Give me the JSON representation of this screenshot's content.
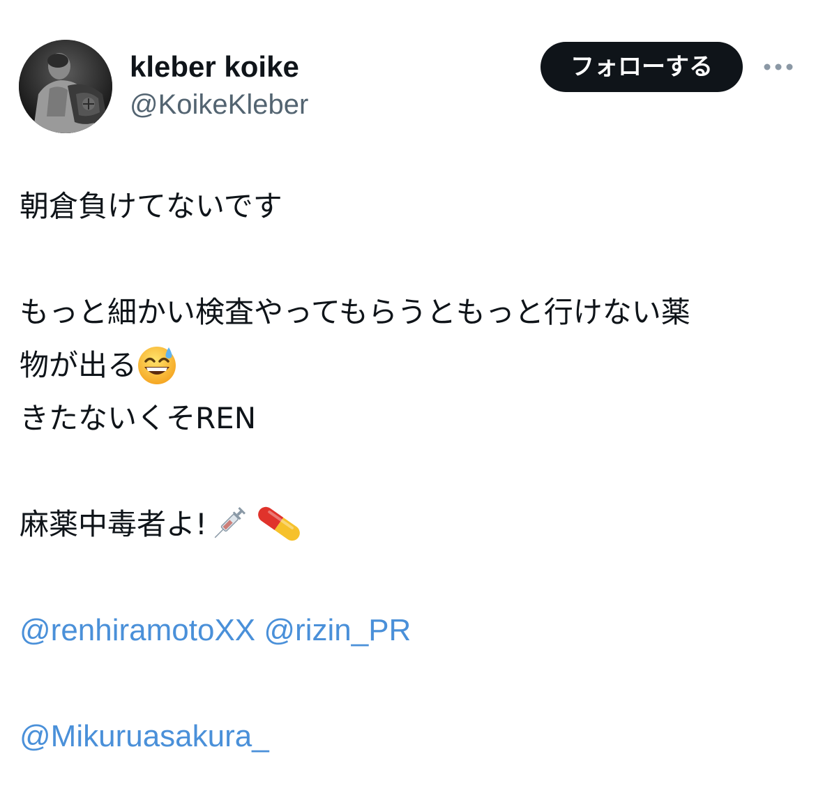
{
  "user": {
    "display_name": "kleber koike",
    "handle": "@KoikeKleber",
    "avatar_icon": "profile-photo"
  },
  "actions": {
    "follow_label": "フォローする",
    "more_icon": "more-dots-icon"
  },
  "tweet": {
    "line1": "朝倉負けてないです",
    "line2": "もっと細かい検査やってもらうともっと行けない薬",
    "line3": "物が出る",
    "line3_emoji": "grinning-sweat-emoji",
    "line4": "きたないくそREN",
    "line5": "麻薬中毒者よ!",
    "line5_emojis": [
      "syringe-emoji",
      "pill-emoji"
    ],
    "mentions_row1": [
      "@renhiramotoXX",
      "@rizin_PR"
    ],
    "mentions_row2": [
      "@Mikuruasakura_"
    ]
  },
  "colors": {
    "text": "#0f1419",
    "secondary": "#536471",
    "link": "#4a90d9",
    "button_bg": "#0f1419"
  }
}
